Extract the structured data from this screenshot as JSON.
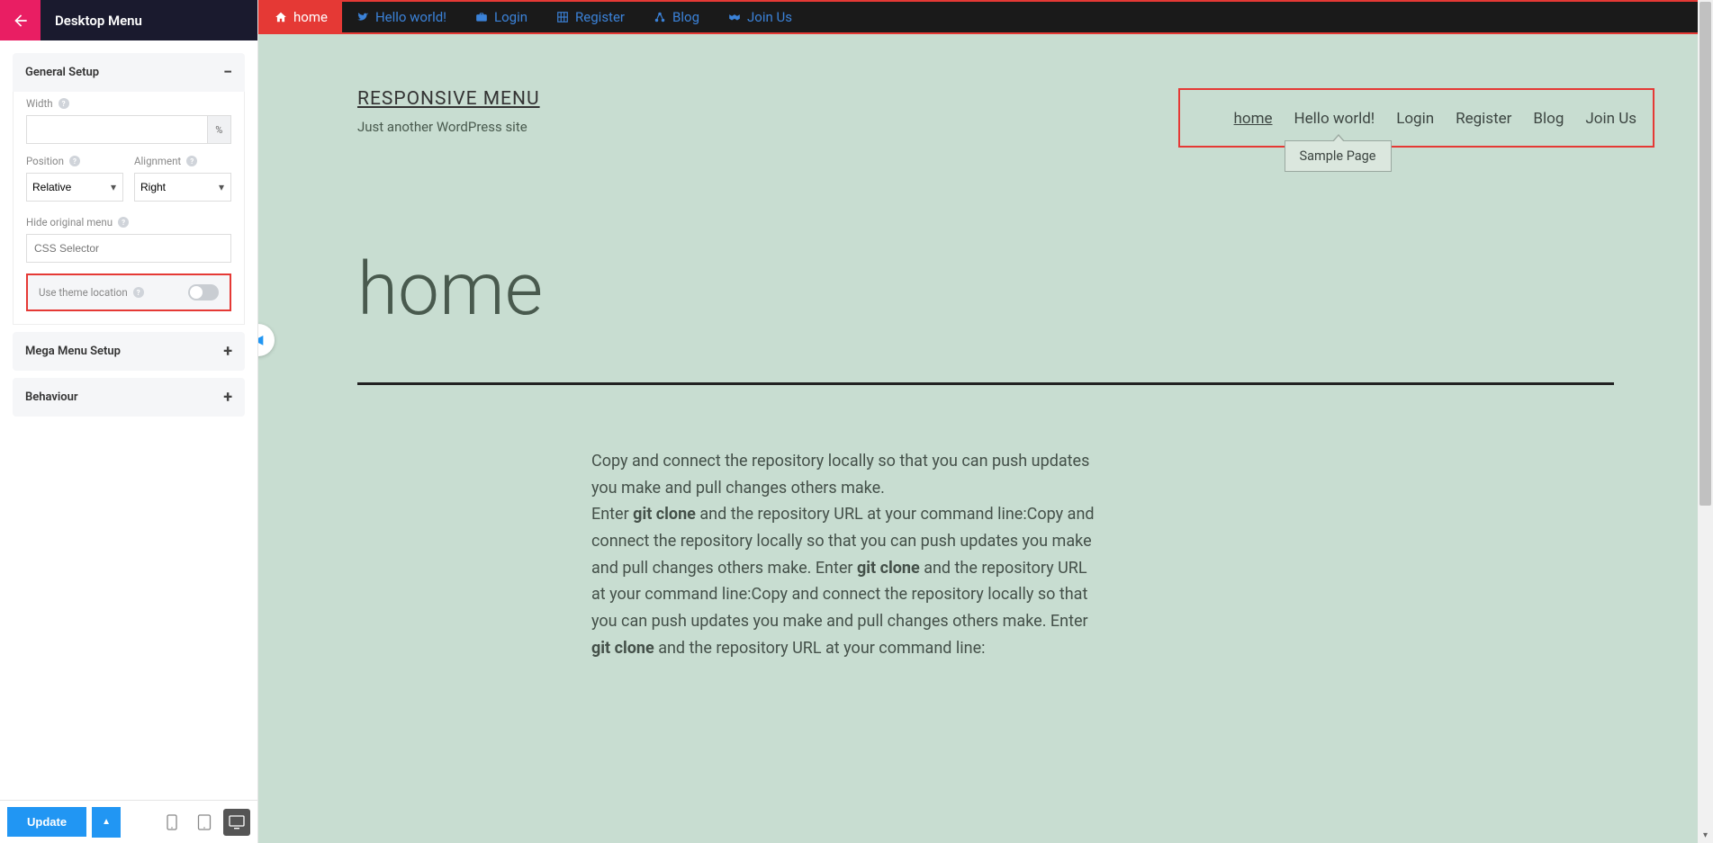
{
  "sidebar": {
    "title": "Desktop Menu",
    "panels": {
      "general": {
        "title": "General Setup",
        "width_label": "Width",
        "width_unit": "%",
        "position_label": "Position",
        "position_value": "Relative",
        "alignment_label": "Alignment",
        "alignment_value": "Right",
        "hide_original_label": "Hide original menu",
        "hide_original_placeholder": "CSS Selector",
        "theme_location_label": "Use theme location"
      },
      "mega": {
        "title": "Mega Menu Setup"
      },
      "behaviour": {
        "title": "Behaviour"
      }
    },
    "update_label": "Update"
  },
  "topnav": {
    "items": [
      {
        "label": "home",
        "icon": "home-icon",
        "active": true
      },
      {
        "label": "Hello world!",
        "icon": "twitter-icon"
      },
      {
        "label": "Login",
        "icon": "briefcase-icon"
      },
      {
        "label": "Register",
        "icon": "grid-icon"
      },
      {
        "label": "Blog",
        "icon": "share-icon"
      },
      {
        "label": "Join Us",
        "icon": "handshake-icon"
      }
    ]
  },
  "site": {
    "title": "RESPONSIVE MENU",
    "tagline": "Just another WordPress site",
    "nav": [
      "home",
      "Hello world!",
      "Login",
      "Register",
      "Blog",
      "Join Us"
    ],
    "dropdown": "Sample Page"
  },
  "page": {
    "heading": "home",
    "para1": "Copy and connect the repository locally so that you can push updates you make and pull changes others make.",
    "enter_label": "Enter ",
    "git_clone": "git clone",
    "para2a": " and the repository URL at your command line:Copy and connect the repository locally so that you can push updates you make and pull changes others make. Enter ",
    "para2b": " and the repository URL at your command line:Copy and connect the repository locally so that you can push updates you make and pull changes others make. Enter ",
    "para2c": " and the repository URL at your command line:"
  }
}
